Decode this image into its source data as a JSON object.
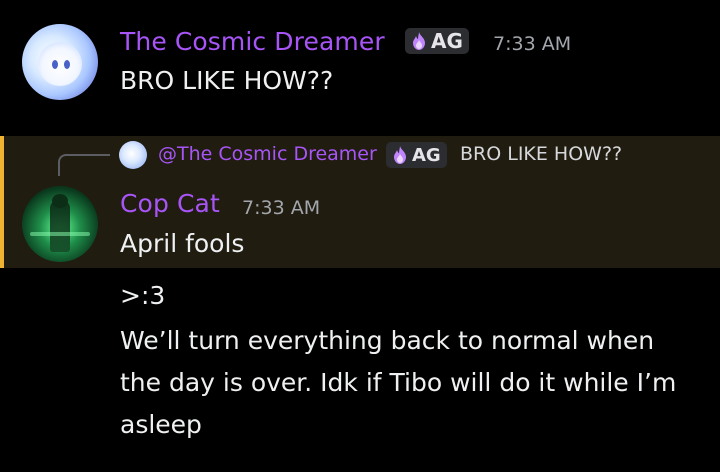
{
  "colors": {
    "background": "#000000",
    "username": "#a855f7",
    "timestamp": "#a3a6ad",
    "message_text": "#eef0f2",
    "highlight_bg": "#201c10",
    "highlight_bar": "#f0b232",
    "badge_bg": "#2b2d31"
  },
  "message1": {
    "username": "The Cosmic Dreamer",
    "badge_icon": "purple-flame-icon",
    "badge_tag": "AG",
    "time": "7:33 AM",
    "text": "BRO LIKE HOW??"
  },
  "reply": {
    "mention": "@The Cosmic Dreamer",
    "badge_icon": "purple-flame-icon",
    "badge_tag": "AG",
    "text": "BRO LIKE HOW??"
  },
  "message2": {
    "username": "Cop Cat",
    "time": "7:33 AM",
    "lines": [
      "April fools",
      ">:3",
      "We’ll turn everything back to normal when",
      "the day is over. Idk if Tibo will do it while I’m",
      "asleep"
    ]
  }
}
